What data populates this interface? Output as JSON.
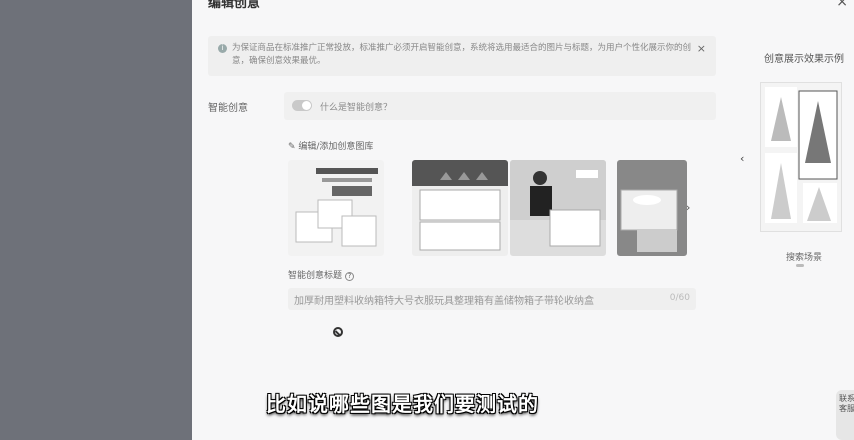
{
  "drawer": {
    "title": "编辑创意",
    "close": "×"
  },
  "notice": {
    "icon": "info-icon",
    "text": "为保证商品在标准推广正常投放，标准推广必须开启智能创意，系统将选用最适合的图片与标题，为用户个性化展示你的创意，确保创意效果最优。",
    "close": "×"
  },
  "smart": {
    "label": "智能创意",
    "enabled": false,
    "help": "什么是智能创意？"
  },
  "gallery": {
    "edit_link": "✎ 编辑/添加创意图库",
    "next": "›"
  },
  "title_field": {
    "label": "智能创意标题",
    "help_icon": "?",
    "value": "加厚耐用塑料收纳箱特大号衣服玩具整理箱有盖储物箱子带轮收纳盒",
    "counter": "0/60"
  },
  "preview": {
    "title": "创意展示效果示例",
    "prev": "‹",
    "caption": "搜索场景"
  },
  "subtitle": "比如说哪些图是我们要测试的",
  "service": "联系客服",
  "colors": {
    "overlay": "#6e7179",
    "drawer_bg": "#f7f7f8",
    "accent": "#333333"
  }
}
